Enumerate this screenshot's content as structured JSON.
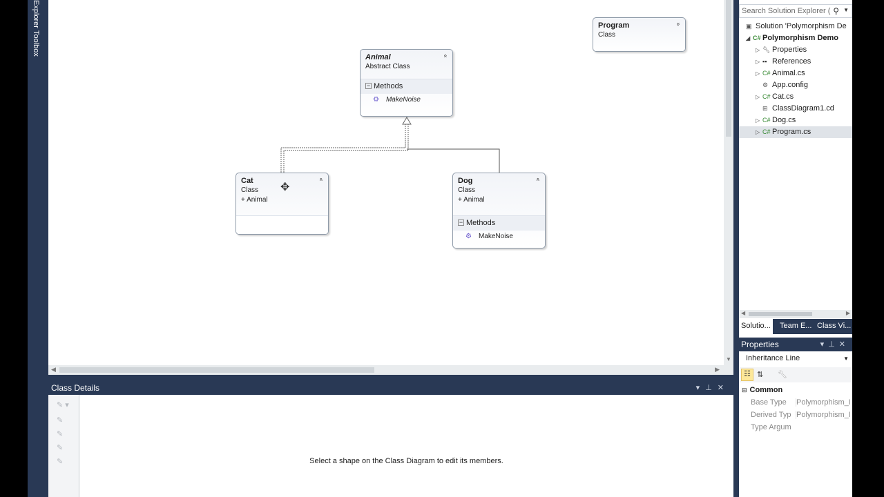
{
  "left_strip": {
    "tabs": [
      "Explorer",
      "Toolbox"
    ]
  },
  "diagram": {
    "shapes": {
      "program": {
        "name": "Program",
        "kind": "Class",
        "toggle": "»"
      },
      "animal": {
        "name": "Animal",
        "kind": "Abstract Class",
        "section": "Methods",
        "member": "MakeNoise",
        "toggle": "«"
      },
      "cat": {
        "name": "Cat",
        "kind": "Class",
        "base": "Animal",
        "toggle": "«"
      },
      "dog": {
        "name": "Dog",
        "kind": "Class",
        "base": "Animal",
        "section": "Methods",
        "member": "MakeNoise",
        "toggle": "«"
      }
    },
    "colors": {
      "connector": "#9aa3ae",
      "selected_connector": "#555555"
    }
  },
  "class_details": {
    "title": "Class Details",
    "hint": "Select a shape on the Class Diagram to edit its members."
  },
  "solution_explorer": {
    "search_placeholder": "Search Solution Explorer (",
    "nodes": [
      {
        "label": "Solution 'Polymorphism De",
        "icon": "solution-icon",
        "level": 0
      },
      {
        "label": "Polymorphism Demo",
        "icon": "csharp-project-icon",
        "level": 1,
        "bold": true,
        "expanded": true
      },
      {
        "label": "Properties",
        "icon": "wrench-icon",
        "level": 2
      },
      {
        "label": "References",
        "icon": "references-icon",
        "level": 2
      },
      {
        "label": "Animal.cs",
        "icon": "csharp-file-icon",
        "level": 2
      },
      {
        "label": "App.config",
        "icon": "config-file-icon",
        "level": 2
      },
      {
        "label": "Cat.cs",
        "icon": "csharp-file-icon",
        "level": 2
      },
      {
        "label": "ClassDiagram1.cd",
        "icon": "class-diagram-icon",
        "level": 2
      },
      {
        "label": "Dog.cs",
        "icon": "csharp-file-icon",
        "level": 2
      },
      {
        "label": "Program.cs",
        "icon": "csharp-file-icon",
        "level": 2,
        "selected": true
      }
    ],
    "bottom_tabs": [
      "Solutio...",
      "Team E...",
      "Class Vi..."
    ]
  },
  "properties": {
    "title": "Properties",
    "selected_object": "Inheritance Line",
    "category": "Common",
    "rows": [
      {
        "name": "Base Type",
        "value": "Polymorphism_I"
      },
      {
        "name": "Derived Typ",
        "value": "Polymorphism_I"
      },
      {
        "name": "Type Argum",
        "value": ""
      }
    ]
  }
}
